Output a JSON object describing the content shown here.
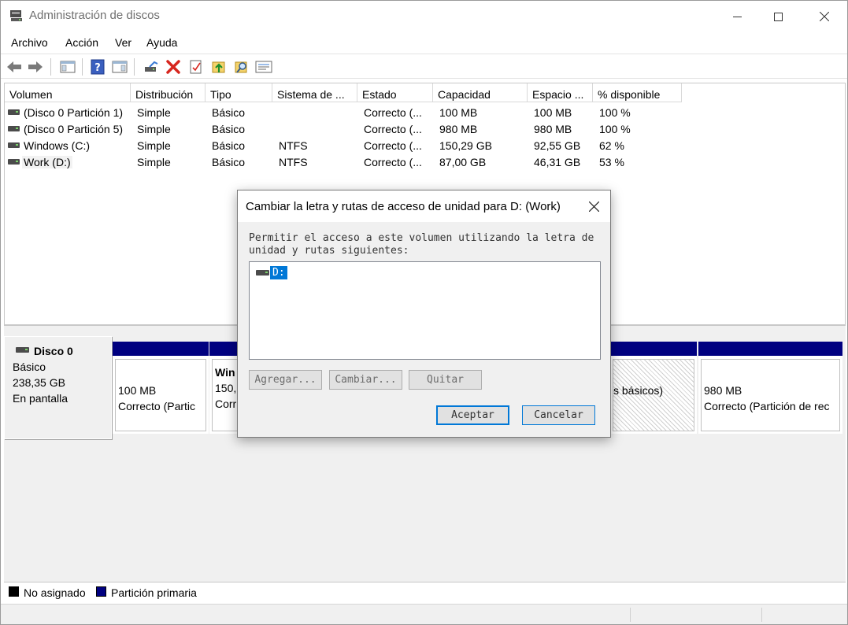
{
  "window": {
    "title": "Administración de discos"
  },
  "menu": [
    "Archivo",
    "Acción",
    "Ver",
    "Ayuda"
  ],
  "toolbar_icons": [
    "back-arrow-icon",
    "forward-arrow-icon",
    "console-tree-icon",
    "help-icon",
    "action-pane-icon",
    "connect-disk-icon",
    "delete-icon",
    "properties-icon",
    "up-folder-icon",
    "search-icon",
    "list-view-icon"
  ],
  "volume_list": {
    "headers": [
      "Volumen",
      "Distribución",
      "Tipo",
      "Sistema de ...",
      "Estado",
      "Capacidad",
      "Espacio ...",
      "% disponible"
    ],
    "rows": [
      [
        "(Disco 0 Partición 1)",
        "Simple",
        "Básico",
        "",
        "Correcto (...",
        "100 MB",
        "100 MB",
        "100 %"
      ],
      [
        "(Disco 0 Partición 5)",
        "Simple",
        "Básico",
        "",
        "Correcto (...",
        "980 MB",
        "980 MB",
        "100 %"
      ],
      [
        "Windows (C:)",
        "Simple",
        "Básico",
        "NTFS",
        "Correcto (...",
        "150,29 GB",
        "92,55 GB",
        "62 %"
      ],
      [
        "Work (D:)",
        "Simple",
        "Básico",
        "NTFS",
        "Correcto (...",
        "87,00 GB",
        "46,31 GB",
        "53 %"
      ]
    ]
  },
  "disk": {
    "name": "Disco 0",
    "type": "Básico",
    "size": "238,35 GB",
    "status": "En pantalla",
    "partitions": [
      {
        "line1": "100 MB",
        "line2": "Correcto (Partic"
      },
      {
        "line1": "Win",
        "line2": "150,",
        "line3": "Corr"
      },
      {
        "line1": "",
        "line2": "s básicos)"
      },
      {
        "line1": "980 MB",
        "line2": "Correcto (Partición de rec"
      }
    ]
  },
  "legend": {
    "unassigned": "No asignado",
    "primary": "Partición primaria",
    "unassigned_color": "#000000",
    "primary_color": "#000080"
  },
  "dialog": {
    "title": "Cambiar la letra y rutas de acceso de unidad para D: (Work)",
    "description": "Permitir el acceso a este volumen utilizando la letra de unidad y rutas siguientes:",
    "drive": "D:",
    "add_label": "Agregar...",
    "change_label": "Cambiar...",
    "remove_label": "Quitar",
    "ok_label": "Aceptar",
    "cancel_label": "Cancelar"
  }
}
